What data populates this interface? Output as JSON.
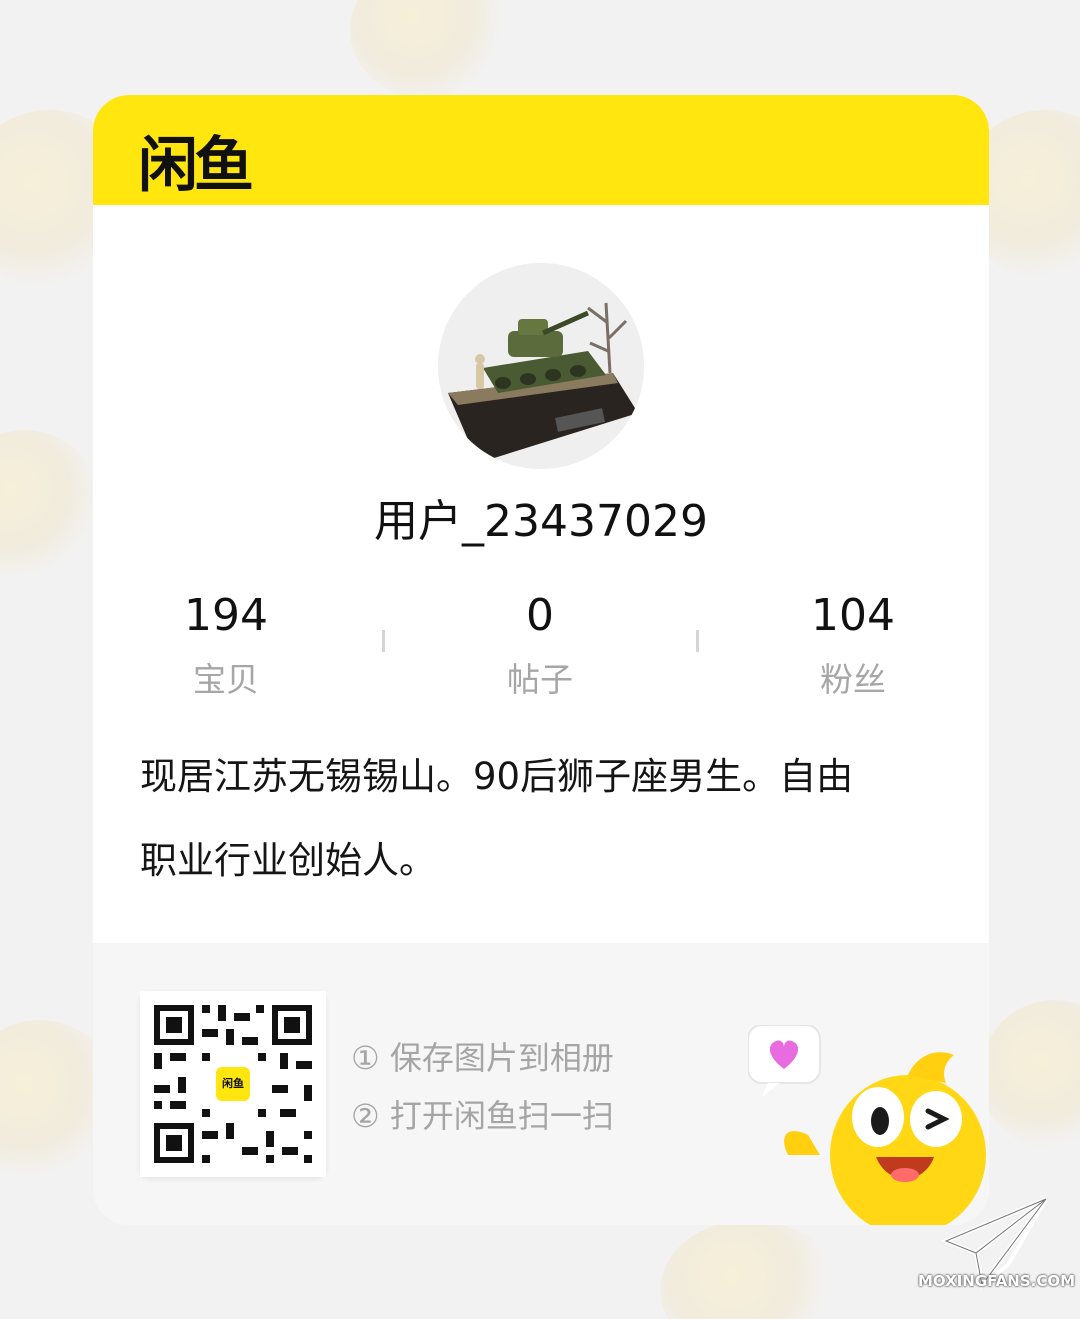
{
  "brand": {
    "name": "闲鱼",
    "accent_color": "#ffe60f"
  },
  "profile": {
    "username": "用户_23437029",
    "avatar": "tank-model-avatar"
  },
  "stats": [
    {
      "value": "194",
      "label": "宝贝"
    },
    {
      "value": "0",
      "label": "帖子"
    },
    {
      "value": "104",
      "label": "粉丝"
    }
  ],
  "bio": {
    "line1": "现居江苏无锡锡山。90后狮子座男生。自由",
    "line2": "职业行业创始人。"
  },
  "share": {
    "qr_badge": "闲鱼",
    "step1": "① 保存图片到相册",
    "step2": "② 打开闲鱼扫一扫"
  },
  "watermark": {
    "text": "MOXINGFANS.COM"
  }
}
